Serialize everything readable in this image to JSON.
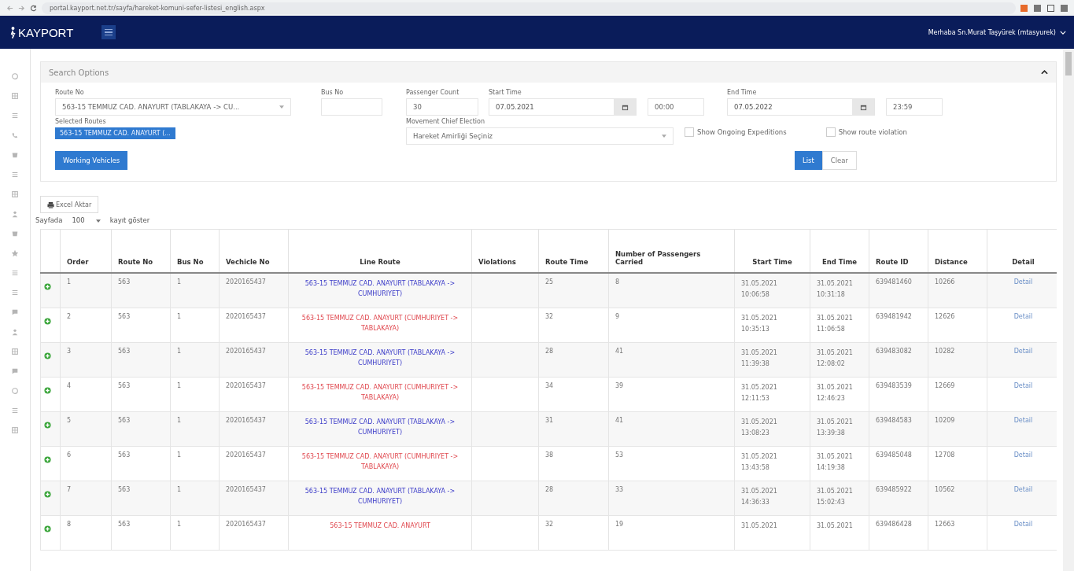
{
  "browser": {
    "url": "portal.kayport.net.tr/sayfa/hareket-komuni-sefer-listesi_english.aspx"
  },
  "navbar": {
    "brand": "KAYPORT",
    "user": "Merhaba Sn.Murat Taşyürek (mtasyurek)"
  },
  "search_panel": {
    "title": "Search Options",
    "expanded": true,
    "route_no": {
      "label": "Route No",
      "value": "563-15 TEMMUZ CAD. ANAYURT (TABLAKAYA -> CU..."
    },
    "bus_no": {
      "label": "Bus No"
    },
    "passenger_count": {
      "label": "Passenger Count",
      "value": "30"
    },
    "start_time": {
      "label": "Start Time",
      "date": "07.05.2021",
      "time": "00:00"
    },
    "end_time": {
      "label": "End Time",
      "date": "07.05.2022",
      "time": "23:59"
    },
    "selected_routes": {
      "label": "Selected Routes",
      "items": [
        "563-15 TEMMUZ CAD. ANAYURT (..."
      ]
    },
    "movement_chief": {
      "label": "Movement Chief Election",
      "value": "Hareket Amirliği Seçiniz"
    },
    "checkboxes": [
      {
        "label": "Show Ongoing Expeditions",
        "checked": false
      },
      {
        "label": "Show route violation",
        "checked": false
      }
    ],
    "working_vehicles_button": "Working Vehicles",
    "list_button": "List",
    "clear_button": "Clear"
  },
  "export_button": "Excel Aktar",
  "page_size": {
    "before": "Sayfada",
    "value": "100",
    "after": "kayıt göster"
  },
  "table": {
    "columns": [
      "Order",
      "Route No",
      "Bus No",
      "Vechicle No",
      "Line Route",
      "Violations",
      "Route Time",
      "Number of Passengers Carried",
      "Start Time",
      "End Time",
      "Route ID",
      "Distance",
      "Detail"
    ],
    "rows": [
      {
        "order": "1",
        "route_no": "563",
        "bus_no": "1",
        "vehicle_no": "2020165437",
        "line_route": "563-15 TEMMUZ CAD. ANAYURT (TABLAKAYA -> CUMHURIYET)",
        "color": "#3b3bc8",
        "route_time": "25",
        "passengers": "8",
        "start": [
          "31.05.2021",
          "10:06:58"
        ],
        "end": [
          "31.05.2021",
          "10:31:18"
        ],
        "route_id": "639481460",
        "distance": "10266",
        "detail": "Detail"
      },
      {
        "order": "2",
        "route_no": "563",
        "bus_no": "1",
        "vehicle_no": "2020165437",
        "line_route": "563-15 TEMMUZ CAD. ANAYURT (CUMHURIYET -> TABLAKAYA)",
        "color": "#e0484f",
        "route_time": "32",
        "passengers": "9",
        "start": [
          "31.05.2021",
          "10:35:13"
        ],
        "end": [
          "31.05.2021",
          "11:06:58"
        ],
        "route_id": "639481942",
        "distance": "12626",
        "detail": "Detail"
      },
      {
        "order": "3",
        "route_no": "563",
        "bus_no": "1",
        "vehicle_no": "2020165437",
        "line_route": "563-15 TEMMUZ CAD. ANAYURT (TABLAKAYA -> CUMHURIYET)",
        "color": "#3b3bc8",
        "route_time": "28",
        "passengers": "41",
        "start": [
          "31.05.2021",
          "11:39:38"
        ],
        "end": [
          "31.05.2021",
          "12:08:02"
        ],
        "route_id": "639483082",
        "distance": "10282",
        "detail": "Detail"
      },
      {
        "order": "4",
        "route_no": "563",
        "bus_no": "1",
        "vehicle_no": "2020165437",
        "line_route": "563-15 TEMMUZ CAD. ANAYURT (CUMHURIYET -> TABLAKAYA)",
        "color": "#e0484f",
        "route_time": "34",
        "passengers": "39",
        "start": [
          "31.05.2021",
          "12:11:53"
        ],
        "end": [
          "31.05.2021",
          "12:46:23"
        ],
        "route_id": "639483539",
        "distance": "12669",
        "detail": "Detail"
      },
      {
        "order": "5",
        "route_no": "563",
        "bus_no": "1",
        "vehicle_no": "2020165437",
        "line_route": "563-15 TEMMUZ CAD. ANAYURT (TABLAKAYA -> CUMHURIYET)",
        "color": "#3b3bc8",
        "route_time": "31",
        "passengers": "41",
        "start": [
          "31.05.2021",
          "13:08:23"
        ],
        "end": [
          "31.05.2021",
          "13:39:38"
        ],
        "route_id": "639484583",
        "distance": "10209",
        "detail": "Detail"
      },
      {
        "order": "6",
        "route_no": "563",
        "bus_no": "1",
        "vehicle_no": "2020165437",
        "line_route": "563-15 TEMMUZ CAD. ANAYURT (CUMHURIYET -> TABLAKAYA)",
        "color": "#e0484f",
        "route_time": "38",
        "passengers": "53",
        "start": [
          "31.05.2021",
          "13:43:58"
        ],
        "end": [
          "31.05.2021",
          "14:19:38"
        ],
        "route_id": "639485048",
        "distance": "12708",
        "detail": "Detail"
      },
      {
        "order": "7",
        "route_no": "563",
        "bus_no": "1",
        "vehicle_no": "2020165437",
        "line_route": "563-15 TEMMUZ CAD. ANAYURT (TABLAKAYA -> CUMHURIYET)",
        "color": "#3b3bc8",
        "route_time": "28",
        "passengers": "33",
        "start": [
          "31.05.2021",
          "14:36:33"
        ],
        "end": [
          "31.05.2021",
          "15:02:43"
        ],
        "route_id": "639485922",
        "distance": "10562",
        "detail": "Detail"
      },
      {
        "order": "8",
        "route_no": "563",
        "bus_no": "1",
        "vehicle_no": "2020165437",
        "line_route": "563-15 TEMMUZ CAD. ANAYURT",
        "color": "#e0484f",
        "route_time": "32",
        "passengers": "19",
        "start": [
          "31.05.2021"
        ],
        "end": [
          "31.05.2021"
        ],
        "route_id": "639486428",
        "distance": "12663",
        "detail": "Detail"
      }
    ]
  }
}
